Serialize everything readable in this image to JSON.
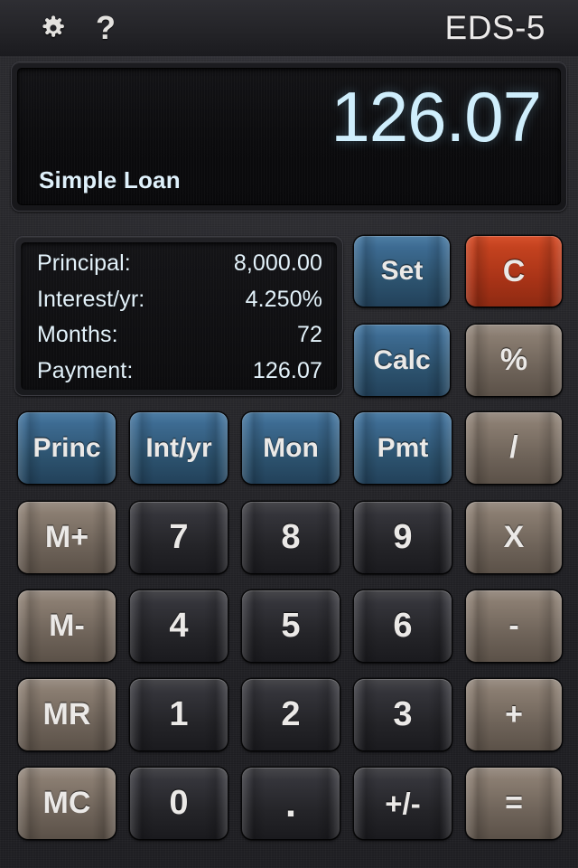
{
  "app": {
    "title": "EDS-5"
  },
  "topbar": {
    "settings_icon": "gear-icon",
    "help_icon": "question-mark-icon",
    "help_label": "?"
  },
  "display": {
    "value": "126.07",
    "mode_label": "Simple Loan",
    "value_color": "#cfeefc",
    "background_color": "#0b0b0d"
  },
  "info_panel": {
    "rows": [
      {
        "label": "Principal:",
        "value": "8,000.00"
      },
      {
        "label": "Interest/yr:",
        "value": "4.250%"
      },
      {
        "label": "Months:",
        "value": "72"
      },
      {
        "label": "Payment:",
        "value": "126.07"
      }
    ]
  },
  "action_buttons": {
    "set": {
      "label": "Set",
      "color": "#3d6b92"
    },
    "calc": {
      "label": "Calc",
      "color": "#3d6b92"
    },
    "clear": {
      "label": "C",
      "color": "#c4421f"
    },
    "percent": {
      "label": "%",
      "color": "#8a7d71"
    }
  },
  "keypad": {
    "row_functions": [
      {
        "label": "Princ",
        "style": "blue"
      },
      {
        "label": "Int/yr",
        "style": "blue"
      },
      {
        "label": "Mon",
        "style": "blue"
      },
      {
        "label": "Pmt",
        "style": "blue"
      },
      {
        "label": "/",
        "style": "tan"
      }
    ],
    "row_789": [
      {
        "label": "M+",
        "style": "tan"
      },
      {
        "label": "7",
        "style": "dark"
      },
      {
        "label": "8",
        "style": "dark"
      },
      {
        "label": "9",
        "style": "dark"
      },
      {
        "label": "X",
        "style": "tan"
      }
    ],
    "row_456": [
      {
        "label": "M-",
        "style": "tan"
      },
      {
        "label": "4",
        "style": "dark"
      },
      {
        "label": "5",
        "style": "dark"
      },
      {
        "label": "6",
        "style": "dark"
      },
      {
        "label": "-",
        "style": "tan"
      }
    ],
    "row_123": [
      {
        "label": "MR",
        "style": "tan"
      },
      {
        "label": "1",
        "style": "dark"
      },
      {
        "label": "2",
        "style": "dark"
      },
      {
        "label": "3",
        "style": "dark"
      },
      {
        "label": "+",
        "style": "tan"
      }
    ],
    "row_0": [
      {
        "label": "MC",
        "style": "tan"
      },
      {
        "label": "0",
        "style": "dark"
      },
      {
        "label": ".",
        "style": "dark"
      },
      {
        "label": "+/-",
        "style": "dark"
      },
      {
        "label": "=",
        "style": "tan"
      }
    ]
  },
  "theme": {
    "background": "#2a2a2e",
    "key_dark": "#34343a",
    "key_blue": "#3d6b92",
    "key_tan": "#8a7d71",
    "key_red": "#c4421f",
    "text": "#ebe9e7"
  }
}
